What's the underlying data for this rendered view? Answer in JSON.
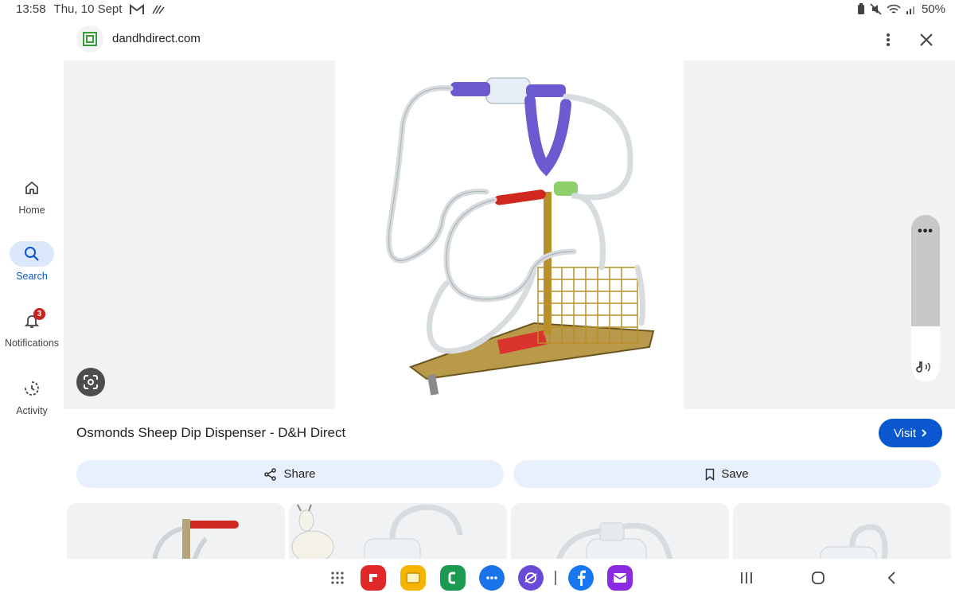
{
  "status_bar": {
    "time": "13:58",
    "date": "Thu, 10 Sept",
    "battery": "50%",
    "icons": [
      "gmail-icon",
      "wave-icon",
      "battery-saver-icon",
      "mute-icon",
      "wifi-icon",
      "signal-icon"
    ]
  },
  "nav": {
    "items": [
      {
        "label": "Home",
        "icon": "home-icon",
        "active": false
      },
      {
        "label": "Search",
        "icon": "search-icon",
        "active": true
      },
      {
        "label": "Notifications",
        "icon": "bell-icon",
        "active": false,
        "badge": "3"
      },
      {
        "label": "Activity",
        "icon": "activity-icon",
        "active": false
      }
    ]
  },
  "header": {
    "site": "dandhdirect.com",
    "more_icon": "more-vert-icon",
    "close_icon": "close-icon"
  },
  "result": {
    "title": "Osmonds Sheep Dip Dispenser - D&H Direct",
    "visit_label": "Visit",
    "share_label": "Share",
    "save_label": "Save"
  },
  "thumbnails": [
    {
      "subject": "dispenser-handle"
    },
    {
      "subject": "goat-and-dispenser"
    },
    {
      "subject": "dispenser-bottle"
    },
    {
      "subject": "dispenser-bottle-2"
    }
  ],
  "taskbar": {
    "apps": [
      {
        "name": "app-drawer-icon",
        "color": "#555555"
      },
      {
        "name": "flipboard-icon",
        "color": "#e12828"
      },
      {
        "name": "notes-icon",
        "color": "#f5b400"
      },
      {
        "name": "phone-icon",
        "color": "#1c9a52"
      },
      {
        "name": "messages-icon",
        "color": "#1a73e8"
      },
      {
        "name": "internet-icon",
        "color": "#6a4bd8"
      },
      {
        "name": "facebook-icon",
        "color": "#1877f2"
      },
      {
        "name": "email-icon",
        "color": "#8a2be2"
      }
    ],
    "nav": [
      "recents-icon",
      "home-button-icon",
      "back-icon"
    ]
  },
  "colors": {
    "accent": "#0b57d0",
    "chip": "#e8f0fe",
    "active_nav": "#dbe8fb"
  }
}
